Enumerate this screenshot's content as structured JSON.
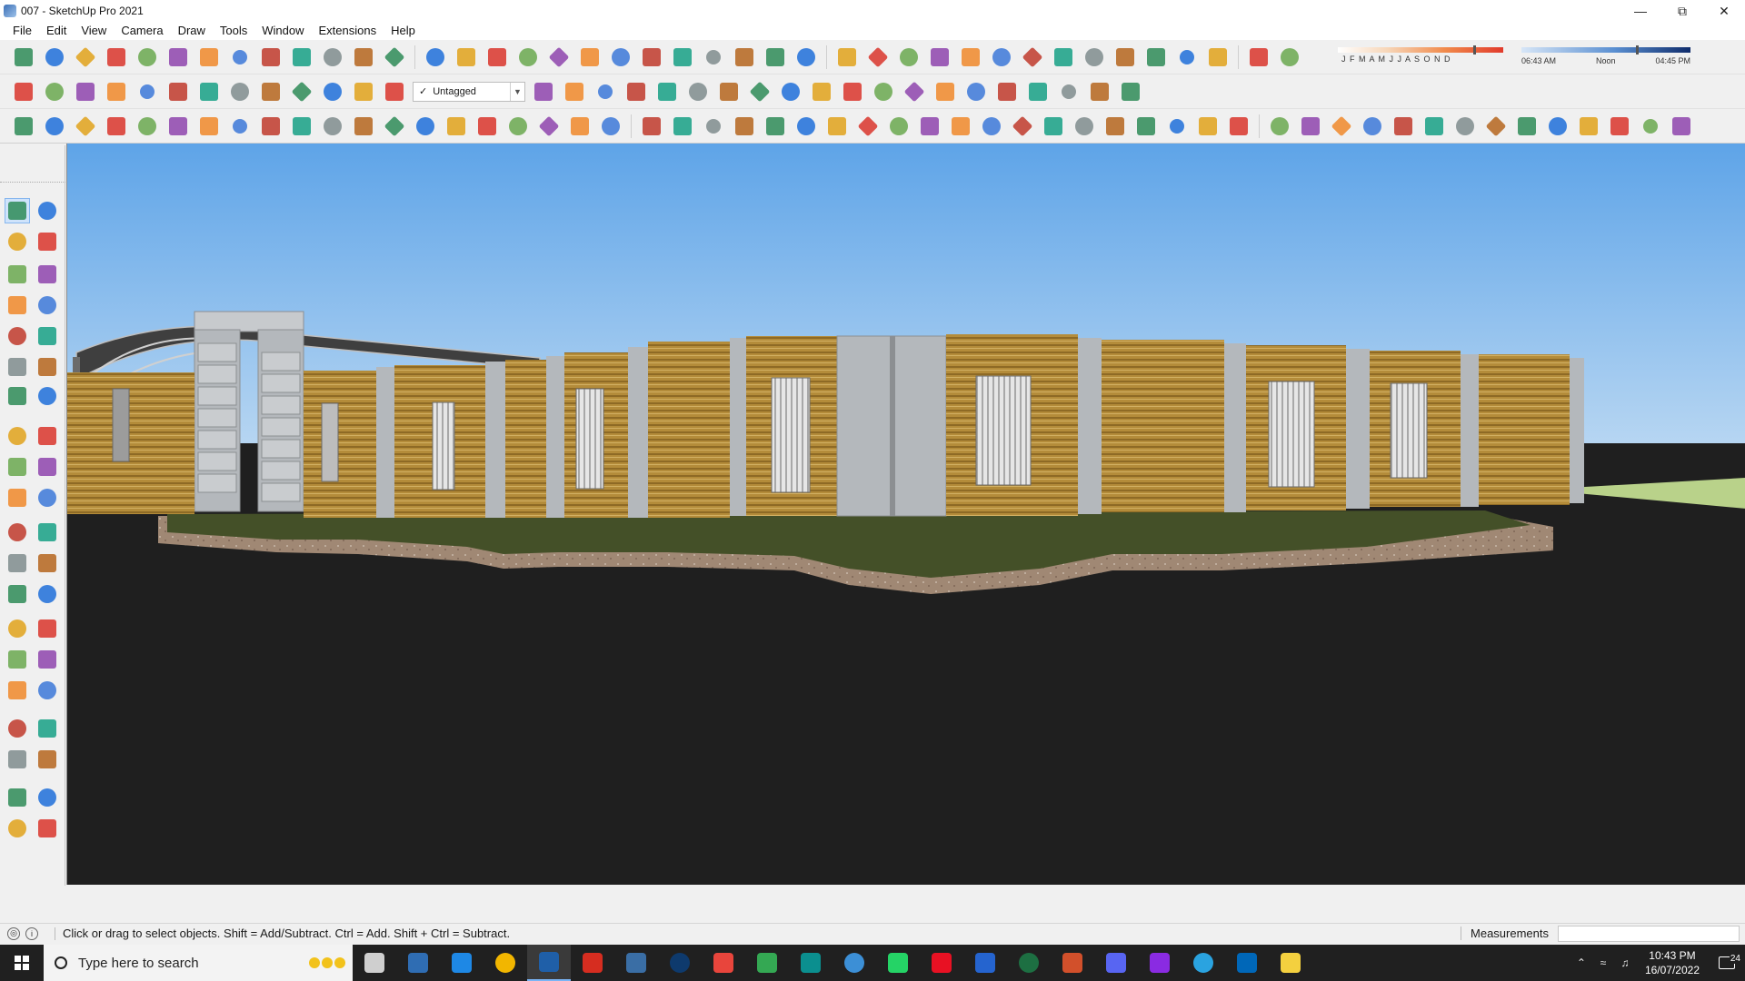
{
  "window": {
    "title": "007 - SketchUp Pro 2021",
    "controls": [
      "minimize",
      "restore",
      "close"
    ]
  },
  "menu": [
    "File",
    "Edit",
    "View",
    "Camera",
    "Draw",
    "Tools",
    "Window",
    "Extensions",
    "Help"
  ],
  "tag_dropdown": {
    "value": "Untagged"
  },
  "shadows": {
    "months": "J F M A M J J A S O N D",
    "month_value": 0.82,
    "time_start": "06:43 AM",
    "time_mid": "Noon",
    "time_end": "04:45 PM",
    "time_value": 0.68
  },
  "toolbar1_icons": [
    "components-icon",
    "3d-warehouse-icon",
    "sandbox-icon",
    "section-blue-icon",
    "solid-yellow-icon",
    "solid-green-icon",
    "solid-red-icon",
    "outer-shell-icon",
    "follow-me-icon",
    "section-plane-icon",
    "section-fill-icon",
    "flip-icon",
    "box-icon",
    "tape-icon",
    "path-icon",
    "bezier-icon",
    "move-red-icon",
    "move-green-icon",
    "scale-icon",
    "cone-icon",
    "cone2-icon",
    "triangle-icon",
    "helix-icon",
    "lasso-icon",
    "rotate-icon",
    "snap-icon",
    "bin-icon",
    "undo-red-icon",
    "group-icon",
    "puzzle-icon",
    "gear-icon",
    "weld-icon",
    "pin-icon",
    "array-icon",
    "frame-icon",
    "grid-orange-icon",
    "grid-orange2-icon",
    "grid-orange3-icon",
    "explode-icon",
    "circle-dash-icon",
    "selection-icon"
  ],
  "toolbar2_icons": [
    "orbit-box-icon",
    "front-view-icon",
    "home-icon",
    "house-icon",
    "house2-icon",
    "push-pull-icon",
    "move-icon",
    "extrude-r-icon",
    "extrude-v-icon",
    "extrude-g-icon",
    "extrude-n-icon",
    "extrude-x-icon",
    "extrude-f-icon"
  ],
  "toolbar2_icons_b": [
    "slash-blue-icon",
    "slash-blue2-icon",
    "slash-blue3-icon",
    "cube-yellow-icon",
    "cube-blue-icon",
    "axis-icon",
    "arrows-up-icon",
    "arrows-down-icon",
    "diagonal-icon",
    "hourglass-icon",
    "undo-blue-icon",
    "redo-red-icon",
    "hand-icon",
    "skin-icon",
    "mesh-icon",
    "drape-icon",
    "stamp-icon",
    "flip-edge-icon",
    "terrain-icon",
    "pyramid-icon"
  ],
  "toolbar3_icons": [
    "freehand-icon",
    "curve-red-icon",
    "fillet-icon",
    "cut-icon",
    "gear-small-icon",
    "loop-icon",
    "spiral-icon",
    "cycle-icon",
    "globe-icon",
    "hook-icon",
    "corner-icon",
    "corner2-icon",
    "line-angle-icon",
    "arc-icon",
    "arch-icon",
    "triangle-outline-icon",
    "stairs-icon",
    "column-icon",
    "hand-grid-icon",
    "shape-icon",
    "wedge-icon",
    "layers-icon",
    "slope-icon",
    "fork-icon",
    "fork2-icon",
    "fork3-icon",
    "stack-icon",
    "hatch-icon",
    "stair-icon",
    "stair2-icon",
    "grate-icon",
    "grate2-icon",
    "fence-icon",
    "wrap-icon",
    "wrap2-icon",
    "wrap3-icon",
    "lines-icon",
    "lines2-icon",
    "dim-icon",
    "label-icon",
    "pencil-red-icon",
    "rect-icon",
    "circle-icon",
    "polygon-icon",
    "ellipse-icon",
    "parallelogram-icon",
    "arc-blue-icon",
    "torus-icon",
    "cone-shape-icon",
    "spline-icon",
    "bezier-blue-icon",
    "ring-icon",
    "arrow-red-icon",
    "eraser-icon"
  ],
  "left_tools": [
    [
      "select-arrow-icon",
      "make-component-icon"
    ],
    [
      "paint-bucket-icon",
      "eraser-icon"
    ],
    [
      "line-pencil-icon",
      "freehand-icon"
    ],
    [
      "rectangle-icon",
      "rotated-rect-icon"
    ],
    [
      "circle-icon",
      "polygon-icon"
    ],
    [
      "arc-icon",
      "two-point-arc-icon"
    ],
    [
      "three-point-arc-icon",
      "pie-icon"
    ],
    [
      "move-icon",
      "push-pull-icon"
    ],
    [
      "rotate-icon",
      "follow-me-icon"
    ],
    [
      "scale-icon",
      "offset-icon"
    ],
    [
      "tape-measure-icon",
      "dimension-icon"
    ],
    [
      "protractor-icon",
      "text-icon"
    ],
    [
      "axes-icon",
      "3d-text-icon"
    ],
    [
      "orbit-icon",
      "pan-icon"
    ],
    [
      "zoom-icon",
      "zoom-window-icon"
    ],
    [
      "zoom-extents-icon",
      "previous-view-icon"
    ],
    [
      "position-camera-icon",
      "look-around-icon"
    ],
    [
      "walk-icon",
      "section-plane-icon"
    ],
    [
      "sandbox-smoove-icon",
      "sandbox-stamp-icon"
    ],
    [
      "sandbox-drape-icon",
      "sandbox-add-detail-icon"
    ]
  ],
  "status": {
    "hint": "Click or drag to select objects. Shift = Add/Subtract. Ctrl = Add. Shift + Ctrl = Subtract.",
    "measurements_label": "Measurements",
    "measurements_value": ""
  },
  "taskbar": {
    "search_placeholder": "Type here to search",
    "apps": [
      "task-view-icon",
      "calculator-icon",
      "edge-icon",
      "file-explorer-icon",
      "sketchup-icon",
      "autocad-icon",
      "sketchup-layout-icon",
      "photoshop-icon",
      "chrome-icon",
      "chrome-alt-icon",
      "enscape-icon",
      "sketchup-style-icon",
      "whatsapp-icon",
      "opera-icon",
      "todo-icon",
      "excel-icon",
      "grammarly-icon",
      "discord-icon",
      "podcast-icon",
      "telegram-icon",
      "cube-app-icon",
      "sticky-notes-icon"
    ],
    "time": "10:43 PM",
    "date": "16/07/2022",
    "notifications": "24"
  },
  "colors": {
    "sky_top": "#5ea4e8",
    "sky_bottom": "#c9e0f4",
    "ground": "#1f1f1f",
    "wall_wood": "#b48c3a",
    "wall_concrete": "#b4b8bc",
    "lawn": "#445028",
    "curb": "#9e8672"
  }
}
